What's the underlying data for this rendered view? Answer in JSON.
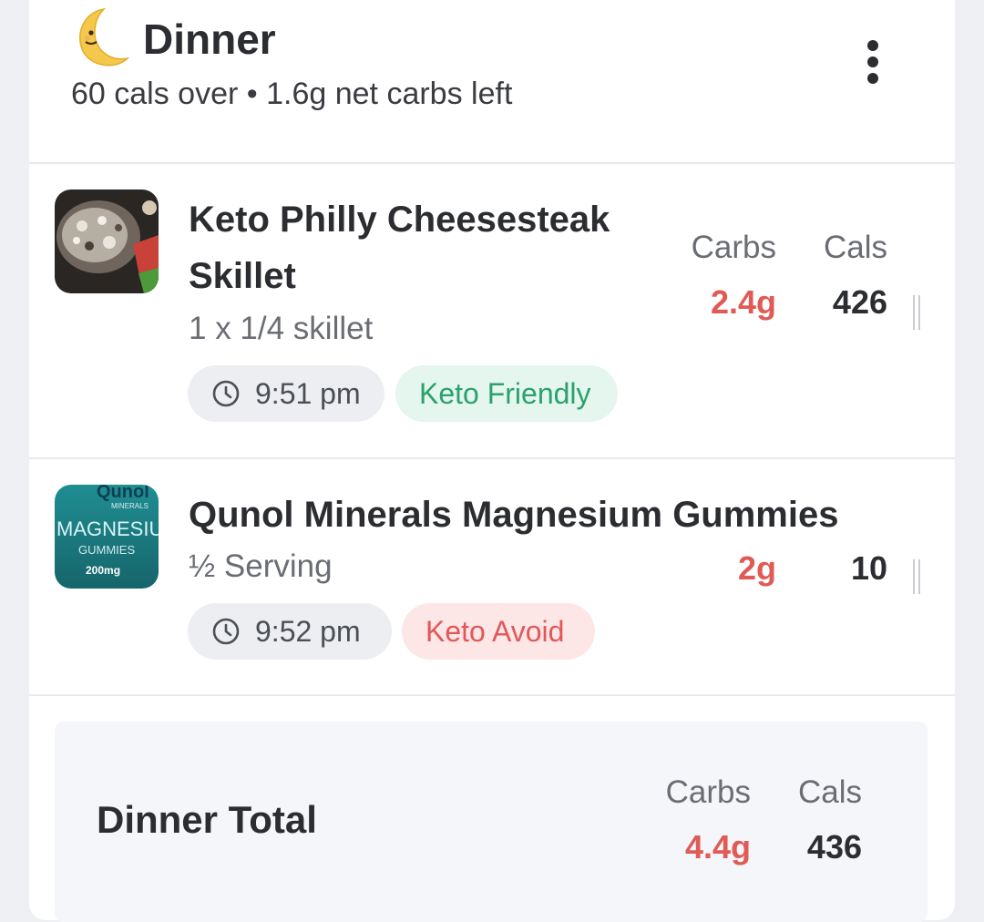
{
  "meal": {
    "icon": "crescent-moon-icon",
    "title": "Dinner",
    "summary": "60 cals over • 1.6g net carbs left",
    "menu_icon": "kebab-menu-icon"
  },
  "entries": [
    {
      "thumb": "cheesesteak-skillet-photo",
      "name_line1": "Keto Philly Cheesesteak",
      "name_line2": "Skillet",
      "serving": "1 x 1/4 skillet",
      "carbs_label": "Carbs",
      "cals_label": "Cals",
      "carbs": "2.4g",
      "cals": "426",
      "time": "9:51 pm",
      "tag": "Keto Friendly",
      "tag_color": "#2aa26b"
    },
    {
      "thumb": "qunol-gummies-photo",
      "thumb_text": {
        "brand": "Qunol",
        "line": "MINERALS",
        "product": "MAGNESIU",
        "sub": "GUMMIES",
        "dose": "200mg"
      },
      "name": "Qunol Minerals Magnesium Gummies",
      "serving": "½ Serving",
      "carbs": "2g",
      "cals": "10",
      "time": "9:52 pm",
      "tag": "Keto Avoid",
      "tag_color": "#e25858"
    }
  ],
  "total": {
    "label": "Dinner Total",
    "carbs_label": "Carbs",
    "cals_label": "Cals",
    "carbs": "4.4g",
    "cals": "436"
  },
  "colors": {
    "carbs": "#e05a56",
    "background": "#eef0f4",
    "card": "#ffffff"
  }
}
